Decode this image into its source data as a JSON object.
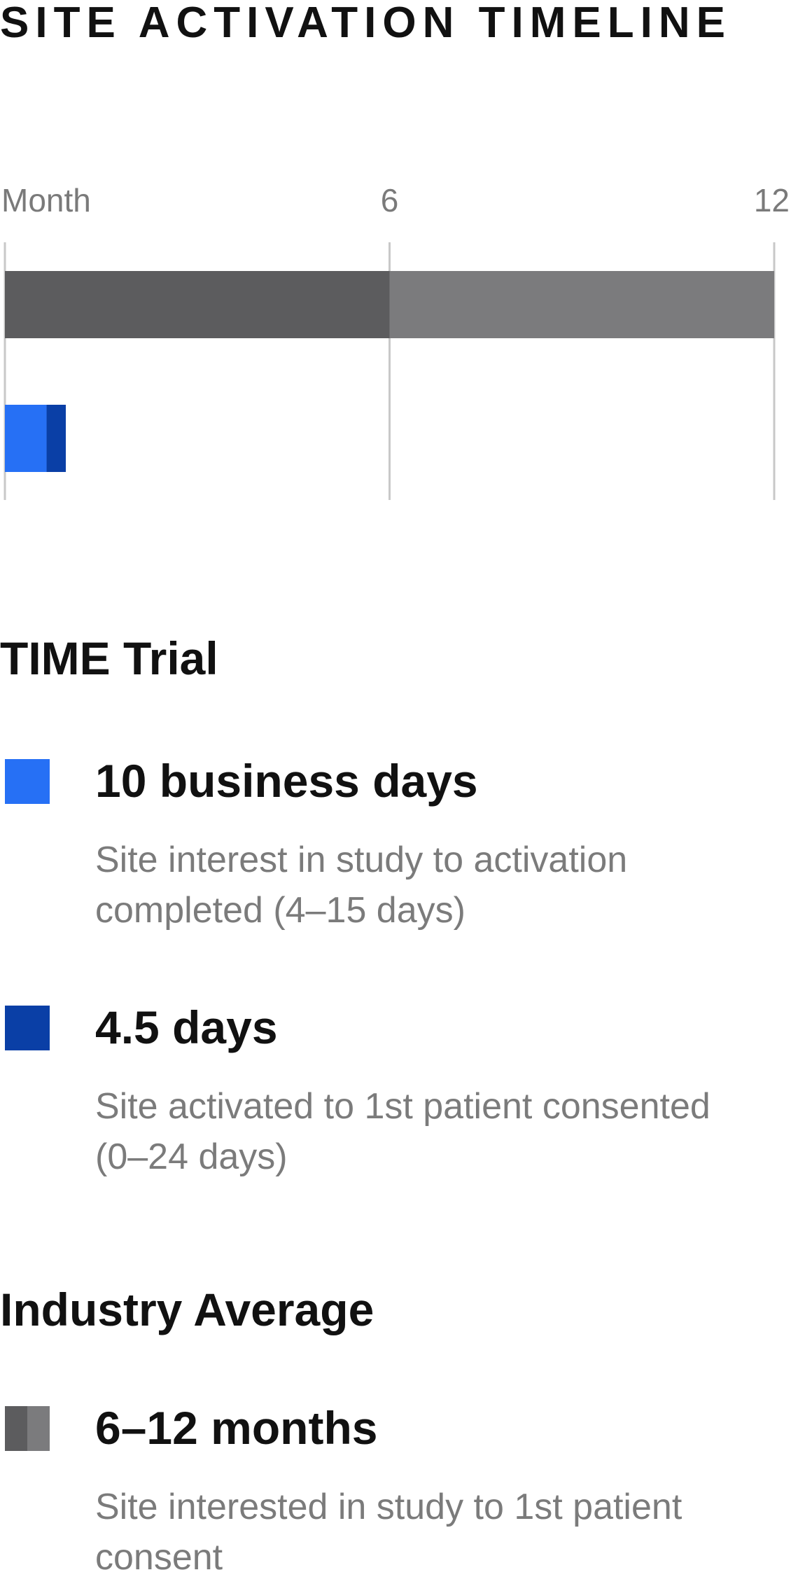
{
  "title": "SITE ACTIVATION TIMELINE",
  "colors": {
    "time_trial_activation": "#2670f5",
    "time_trial_consent": "#0a3fa6",
    "industry_low": "#5c5c5e",
    "industry_high": "#7b7b7d",
    "gridline": "#c8c8c8",
    "tick_label": "#7a7a7a",
    "description": "#7b7b7b"
  },
  "chart_data": {
    "type": "bar",
    "orientation": "horizontal",
    "stacked": true,
    "x_axis": {
      "label": "Month",
      "ticks": [
        6,
        12
      ],
      "range": [
        0,
        12
      ],
      "gridlines_at": [
        0,
        6,
        12
      ]
    },
    "rows": [
      {
        "name": "Industry Average",
        "segments": [
          {
            "start": 0,
            "end": 6,
            "color": "#5c5c5e"
          },
          {
            "start": 6,
            "end": 12,
            "color": "#7b7b7d"
          }
        ]
      },
      {
        "name": "TIME Trial",
        "segments": [
          {
            "start": 0,
            "end": 0.65,
            "color": "#2670f5"
          },
          {
            "start": 0.65,
            "end": 0.95,
            "color": "#0a3fa6"
          }
        ]
      }
    ]
  },
  "sections": {
    "time_trial": {
      "heading": "TIME Trial",
      "items": [
        {
          "value": "10 business days",
          "description": "Site interest in study to activation completed (4–15 days)"
        },
        {
          "value": "4.5 days",
          "description": "Site activated to 1st patient consented (0–24 days)"
        }
      ]
    },
    "industry": {
      "heading": "Industry Average",
      "items": [
        {
          "value": "6–12 months",
          "description": "Site interested in study to 1st patient consent"
        }
      ]
    }
  }
}
